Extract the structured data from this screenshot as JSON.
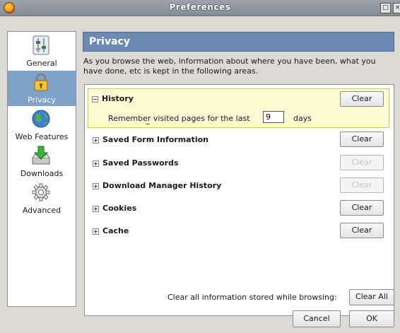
{
  "window": {
    "title": "Preferences",
    "maximize_glyph": "□",
    "close_glyph": "×"
  },
  "sidebar": {
    "items": [
      {
        "label": "General",
        "icon": "sliders-icon",
        "selected": false
      },
      {
        "label": "Privacy",
        "icon": "padlock-icon",
        "selected": true
      },
      {
        "label": "Web Features",
        "icon": "globe-icon",
        "selected": false
      },
      {
        "label": "Downloads",
        "icon": "download-arrow-icon",
        "selected": false
      },
      {
        "label": "Advanced",
        "icon": "gear-icon",
        "selected": false
      }
    ]
  },
  "main": {
    "header": "Privacy",
    "description": "As you browse the web, information about where you have been, what you have done, etc is kept in the following areas.",
    "sections": [
      {
        "label": "History",
        "expanded": true,
        "toggle": "−",
        "button": "Clear",
        "button_enabled": true
      },
      {
        "label": "Saved Form Information",
        "expanded": false,
        "toggle": "+",
        "button": "Clear",
        "button_enabled": true
      },
      {
        "label": "Saved Passwords",
        "expanded": false,
        "toggle": "+",
        "button": "Clear",
        "button_enabled": false
      },
      {
        "label": "Download Manager History",
        "expanded": false,
        "toggle": "+",
        "button": "Clear",
        "button_enabled": false
      },
      {
        "label": "Cookies",
        "expanded": false,
        "toggle": "+",
        "button": "Clear",
        "button_enabled": true
      },
      {
        "label": "Cache",
        "expanded": false,
        "toggle": "+",
        "button": "Clear",
        "button_enabled": true
      }
    ],
    "history": {
      "remember_prefix": "Remember",
      "remember_accel": "_",
      "remember_suffix": " visited pages for the last",
      "days_value": "9",
      "days_label": "days"
    }
  },
  "footer": {
    "clear_all_text": "Clear all information stored while browsing:",
    "clear_all_button": "Clear All",
    "cancel_button": "Cancel",
    "ok_button": "OK"
  },
  "colors": {
    "header_bg": "#6b8bb4",
    "selected_bg": "#7fa2c8",
    "history_bg": "#fbfbd3",
    "window_bg": "#dcdad5"
  }
}
